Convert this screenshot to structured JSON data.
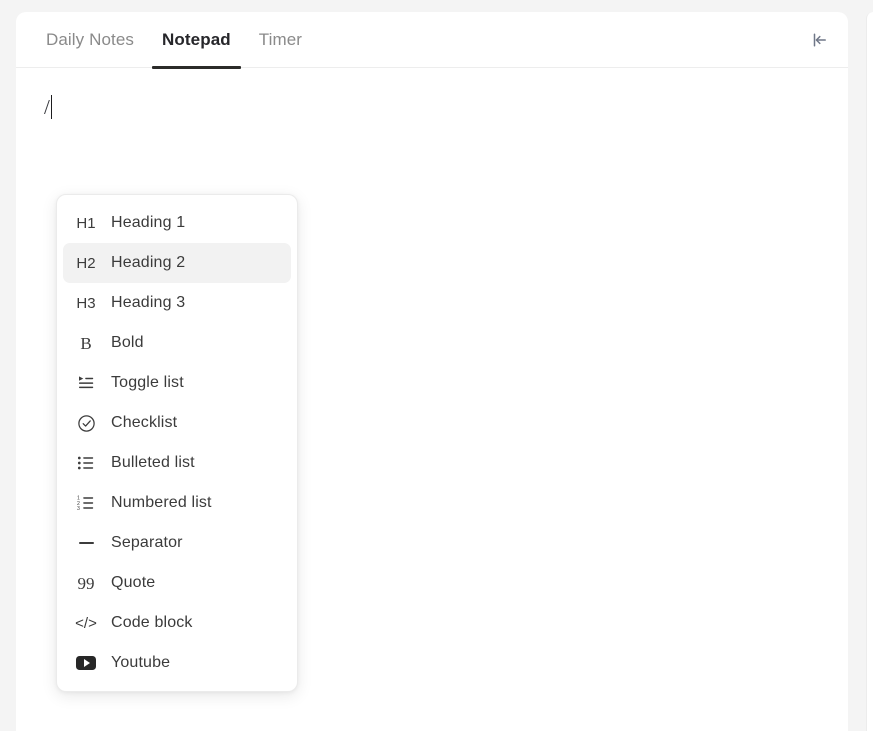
{
  "window": {
    "page_background": "#f4f4f4",
    "card_background": "#ffffff"
  },
  "tabs": {
    "items": [
      {
        "label": "Daily Notes",
        "active": false
      },
      {
        "label": "Notepad",
        "active": true
      },
      {
        "label": "Timer",
        "active": false
      }
    ],
    "active_underline_color": "#2b2b29",
    "collapse_button": {
      "icon": "collapse-left-icon",
      "title": "Collapse"
    }
  },
  "editor": {
    "content": "/",
    "caret_visible": true
  },
  "slash_menu": {
    "selected_index": 1,
    "selected_background": "#f2f2f2",
    "items": [
      {
        "icon": "h1-icon",
        "icon_text": "H1",
        "label": "Heading 1"
      },
      {
        "icon": "h2-icon",
        "icon_text": "H2",
        "label": "Heading 2"
      },
      {
        "icon": "h3-icon",
        "icon_text": "H3",
        "label": "Heading 3"
      },
      {
        "icon": "bold-icon",
        "icon_text": "B",
        "label": "Bold"
      },
      {
        "icon": "toggle-list-icon",
        "icon_text": "",
        "label": "Toggle list"
      },
      {
        "icon": "checklist-icon",
        "icon_text": "",
        "label": "Checklist"
      },
      {
        "icon": "bulleted-list-icon",
        "icon_text": "",
        "label": "Bulleted list"
      },
      {
        "icon": "numbered-list-icon",
        "icon_text": "",
        "label": "Numbered list"
      },
      {
        "icon": "separator-icon",
        "icon_text": "",
        "label": "Separator"
      },
      {
        "icon": "quote-icon",
        "icon_text": "99",
        "label": "Quote"
      },
      {
        "icon": "code-block-icon",
        "icon_text": "</>",
        "label": "Code block"
      },
      {
        "icon": "youtube-icon",
        "icon_text": "",
        "label": "Youtube"
      }
    ]
  }
}
